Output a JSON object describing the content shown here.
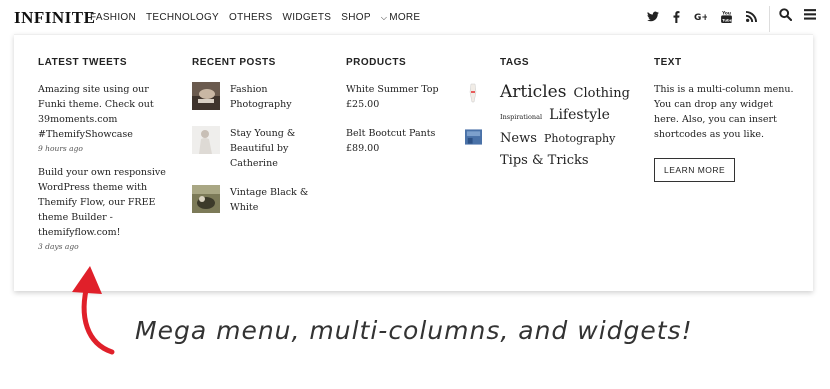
{
  "header": {
    "logo": "INFINITE",
    "nav": [
      "FASHION",
      "TECHNOLOGY",
      "OTHERS",
      "WIDGETS",
      "SHOP",
      "MORE"
    ]
  },
  "tweets": {
    "title": "LATEST TWEETS",
    "items": [
      {
        "text": "Amazing site using our Funki theme. Check out 39moments.com #ThemifyShowcase",
        "time": "9 hours ago"
      },
      {
        "text": "Build your own responsive WordPress theme with Themify Flow, our FREE theme Builder - themifyflow.com!",
        "time": "3 days ago"
      }
    ]
  },
  "recent": {
    "title": "RECENT POSTS",
    "items": [
      "Fashion Photography",
      "Stay Young & Beautiful by Catherine",
      "Vintage Black & White"
    ]
  },
  "products": {
    "title": "PRODUCTS",
    "items": [
      {
        "name": "White Summer Top",
        "price": "£25.00"
      },
      {
        "name": "Belt Bootcut Pants",
        "price": "£89.00"
      }
    ]
  },
  "tags": {
    "title": "TAGS",
    "items": [
      "Articles",
      "Clothing",
      "Inspirational",
      "Lifestyle",
      "News",
      "Photography",
      "Tips & Tricks"
    ]
  },
  "text_widget": {
    "title": "TEXT",
    "body": "This is a multi-column menu. You can drop any widget here. Also, you can insert shortcodes as you like.",
    "button": "LEARN MORE"
  },
  "caption": "Mega menu, multi-columns, and widgets!",
  "colors": {
    "accent": "#e0202a",
    "text": "#222222"
  },
  "icons": [
    "twitter-icon",
    "facebook-icon",
    "google-plus-icon",
    "youtube-icon",
    "rss-icon",
    "search-icon",
    "menu-icon"
  ]
}
